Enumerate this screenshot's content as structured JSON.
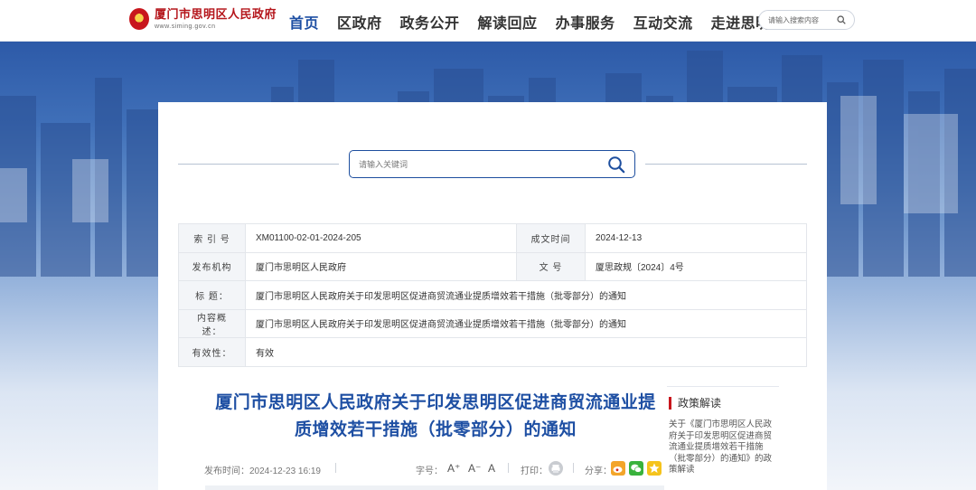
{
  "header": {
    "site_title": "厦门市思明区人民政府",
    "site_url": "www.siming.gov.cn",
    "nav": [
      {
        "label": "首页",
        "active": true
      },
      {
        "label": "区政府",
        "active": false
      },
      {
        "label": "政务公开",
        "active": false
      },
      {
        "label": "解读回应",
        "active": false
      },
      {
        "label": "办事服务",
        "active": false
      },
      {
        "label": "互动交流",
        "active": false
      },
      {
        "label": "走进思明",
        "active": false
      }
    ],
    "search_placeholder": "请输入搜索内容"
  },
  "main_search": {
    "placeholder": "请输入关键词"
  },
  "meta": {
    "index_label": "索 引 号",
    "index_value": "XM01100-02-01-2024-205",
    "date_label": "成文时间",
    "date_value": "2024-12-13",
    "org_label": "发布机构",
    "org_value": "厦门市思明区人民政府",
    "docno_label": "文 号",
    "docno_value": "厦思政规〔2024〕4号",
    "title_label": "标 题：",
    "title_value": "厦门市思明区人民政府关于印发思明区促进商贸流通业提质增效若干措施（批零部分）的通知",
    "summary_label": "内容概述：",
    "summary_value": "厦门市思明区人民政府关于印发思明区促进商贸流通业提质增效若干措施（批零部分）的通知",
    "validity_label": "有效性：",
    "validity_value": "有效"
  },
  "article": {
    "title_line1": "厦门市思明区人民政府关于印发思明区促进商贸流通业提",
    "title_line2": "质增效若干措施（批零部分）的通知",
    "publish_time": "发布时间：2024-12-23 16:19",
    "font_size_label": "字号：",
    "font_large": "A⁺",
    "font_medium": "A⁻",
    "font_normal": "A",
    "print_label": "打印：",
    "share_label": "分享："
  },
  "sidebar": {
    "heading": "政策解读",
    "link_text": "关于《厦门市思明区人民政府关于印发思明区促进商贸流通业提质增效若干措施（批零部分）的通知》的政策解读"
  },
  "colors": {
    "brand_blue": "#1e4fa3",
    "brand_red": "#c8161d"
  }
}
